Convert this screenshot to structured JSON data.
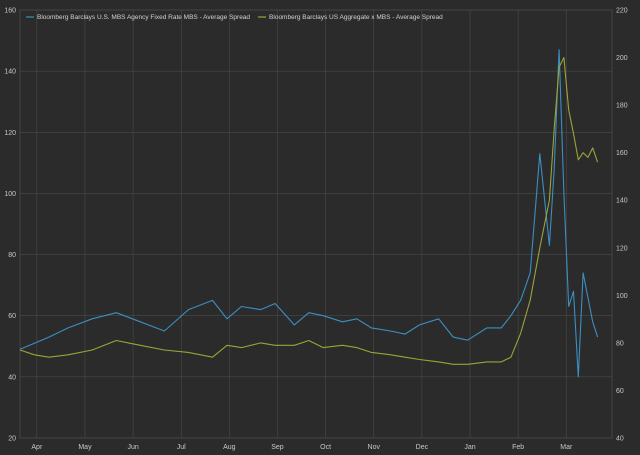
{
  "chart_data": {
    "type": "line",
    "title": "",
    "background_color": "#2b2b2b",
    "grid": true,
    "grid_color": "#4a4a4a",
    "legend_position": "top-left",
    "x_ticks": [
      "Apr",
      "May",
      "Jun",
      "Jul",
      "Aug",
      "Sep",
      "Oct",
      "Nov",
      "Dec",
      "Jan",
      "Feb",
      "Mar"
    ],
    "y_left": {
      "ylim": [
        20,
        160
      ],
      "ticks": [
        20,
        40,
        60,
        80,
        100,
        120,
        140,
        160
      ]
    },
    "y_right": {
      "ylim": [
        40,
        220
      ],
      "ticks": [
        40,
        60,
        80,
        100,
        120,
        140,
        160,
        180,
        200,
        220
      ]
    },
    "series": [
      {
        "name": "Bloomberg Barclays U.S. MBS Agency Fixed Rate MBS - Average Spread",
        "axis": "left",
        "color": "#3b8fc2",
        "x": [
          0,
          0.3,
          0.6,
          1,
          1.5,
          2,
          2.5,
          3,
          3.5,
          4,
          4.3,
          4.6,
          5,
          5.3,
          5.7,
          6,
          6.3,
          6.7,
          7,
          7.3,
          7.7,
          8,
          8.3,
          8.7,
          9,
          9.3,
          9.7,
          10,
          10.2,
          10.4,
          10.6,
          10.8,
          11,
          11.1,
          11.2,
          11.3,
          11.4,
          11.5,
          11.6,
          11.7,
          11.8,
          11.9,
          12
        ],
        "values": [
          49,
          51,
          53,
          56,
          59,
          61,
          58,
          55,
          62,
          65,
          59,
          63,
          62,
          64,
          57,
          61,
          60,
          58,
          59,
          56,
          55,
          54,
          57,
          59,
          53,
          52,
          56,
          56,
          60,
          65,
          74,
          113,
          83,
          108,
          147,
          100,
          63,
          68,
          40,
          74,
          66,
          58,
          53
        ]
      },
      {
        "name": "Bloomberg Barclays US Aggregate x MBS - Average Spread",
        "axis": "right",
        "color": "#9aa537",
        "x": [
          0,
          0.3,
          0.6,
          1,
          1.5,
          2,
          2.5,
          3,
          3.5,
          4,
          4.3,
          4.6,
          5,
          5.3,
          5.7,
          6,
          6.3,
          6.7,
          7,
          7.3,
          7.7,
          8,
          8.3,
          8.7,
          9,
          9.3,
          9.7,
          10,
          10.2,
          10.4,
          10.6,
          10.8,
          11,
          11.1,
          11.2,
          11.3,
          11.4,
          11.5,
          11.6,
          11.7,
          11.8,
          11.9,
          12
        ],
        "values": [
          77,
          75,
          74,
          75,
          77,
          81,
          79,
          77,
          76,
          74,
          79,
          78,
          80,
          79,
          79,
          81,
          78,
          79,
          78,
          76,
          75,
          74,
          73,
          72,
          71,
          71,
          72,
          72,
          74,
          84,
          98,
          120,
          140,
          170,
          196,
          200,
          178,
          168,
          157,
          160,
          158,
          162,
          156
        ]
      }
    ]
  }
}
